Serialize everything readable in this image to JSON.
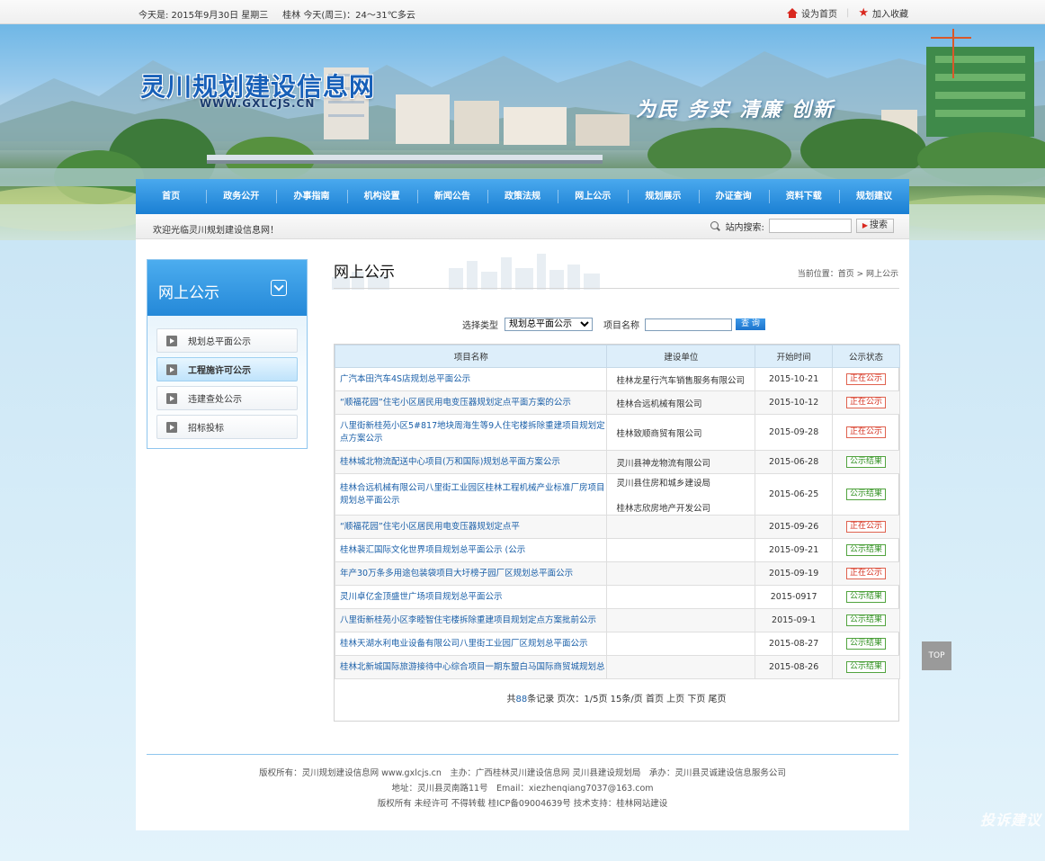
{
  "topbar": {
    "date": "今天是: 2015年9月30日 星期三",
    "weather": "桂林 今天(周三)：24～31℃多云",
    "set_home": "设为首页",
    "sep": "|",
    "bookmark": "加入收藏"
  },
  "banner": {
    "site_title": "灵川规划建设信息网",
    "site_url": "WWW.GXLCJS.CN",
    "slogan": "为民 务实 清廉 创新"
  },
  "nav": [
    "首页",
    "政务公开",
    "办事指南",
    "机构设置",
    "新闻公告",
    "政策法规",
    "网上公示",
    "规划展示",
    "办证查询",
    "资料下载",
    "规划建议"
  ],
  "welcome": {
    "message": "欢迎光临灵川规划建设信息网！",
    "search_label": "站内搜索:",
    "search_button": "搜索"
  },
  "sidebar": {
    "title": "网上公示",
    "items": [
      "规划总平面公示",
      "工程施许可公示",
      "违建查处公示",
      "招标投标"
    ],
    "active_index": 1
  },
  "content": {
    "title": "网上公示",
    "breadcrumb": "当前位置：首页 > 网上公示",
    "filter": {
      "type_label": "选择类型",
      "type_value": "规划总平面公示",
      "name_label": "项目名称",
      "query_button": "查 询"
    },
    "table": {
      "headers": [
        "项目名称",
        "建设单位",
        "开始时间",
        "公示状态"
      ],
      "rows": [
        {
          "name": "广汽本田汽车4S店规划总平面公示",
          "unit": "桂林龙星行汽车销售服务有限公司",
          "date": "2015-10-21",
          "status": "正在公示",
          "state": "on"
        },
        {
          "name": "“顺福花园”住宅小区居民用电变压器规划定点平面方案的公示",
          "unit": "桂林合远机械有限公司",
          "date": "2015-10-12",
          "status": "正在公示",
          "state": "on"
        },
        {
          "name": "八里街新桂苑小区5#817地块周海生等9人住宅楼拆除重建项目规划定点方案公示",
          "unit": "桂林致顺商贸有限公司",
          "date": "2015-09-28",
          "status": "正在公示",
          "state": "on"
        },
        {
          "name": "桂林城北物流配送中心项目(万和国际)规划总平面方案公示",
          "unit": "灵川县神龙物流有限公司",
          "date": "2015-06-28",
          "status": "公示结果",
          "state": "done"
        },
        {
          "name": "桂林合远机械有限公司八里街工业园区桂林工程机械产业标准厂房项目规划总平面公示",
          "unit": "灵川县住房和城乡建设局",
          "unit2": "桂林志欣房地产开发公司",
          "date": "2015-06-25",
          "status": "公示结果",
          "state": "done"
        },
        {
          "name": "“顺福花园”住宅小区居民用电变压器规划定点平",
          "unit": "",
          "date": "2015-09-26",
          "status": "正在公示",
          "state": "on"
        },
        {
          "name": "桂林裴汇国际文化世界项目规划总平面公示 (公示",
          "unit": "",
          "date": "2015-09-21",
          "status": "公示结果",
          "state": "done"
        },
        {
          "name": "年产30万条多用途包装袋项目大圩榜子园厂区规划总平面公示",
          "unit": "",
          "date": "2015-09-19",
          "status": "正在公示",
          "state": "on"
        },
        {
          "name": "灵川卓亿金顶盛世广场项目规划总平面公示",
          "unit": "",
          "date": "2015-0917",
          "status": "公示结果",
          "state": "done"
        },
        {
          "name": "八里街新桂苑小区李睦智住宅楼拆除重建项目规划定点方案批前公示",
          "unit": "",
          "date": "2015-09-1",
          "status": "公示结果",
          "state": "done"
        },
        {
          "name": "桂林天湖水利电业设备有限公司八里街工业园厂区规划总平面公示",
          "unit": "",
          "date": "2015-08-27",
          "status": "公示结果",
          "state": "done"
        },
        {
          "name": "桂林北新城国际旅游接待中心综合项目一期东盟白马国际商贸城规划总",
          "unit": "",
          "date": "2015-08-26",
          "status": "公示结果",
          "state": "done"
        }
      ]
    },
    "pager": {
      "prefix": "共",
      "total": "88",
      "rest": "条记录 页次：1/5页 15条/页 首页 上页 下页 尾页"
    }
  },
  "footer": {
    "line1": "版权所有：灵川规划建设信息网 www.gxlcjs.cn　主办：广西桂林灵川建设信息网 灵川县建设规划局　承办：灵川县灵诚建设信息服务公司",
    "line2": "地址：灵川县灵南路11号　Email：xiezhenqiang7037@163.com",
    "line3": "版权所有 未经许可 不得转载  桂ICP备09004639号 技术支持：桂林网站建设"
  },
  "floating": {
    "top_label": "TOP",
    "side_text": "投诉建议"
  }
}
